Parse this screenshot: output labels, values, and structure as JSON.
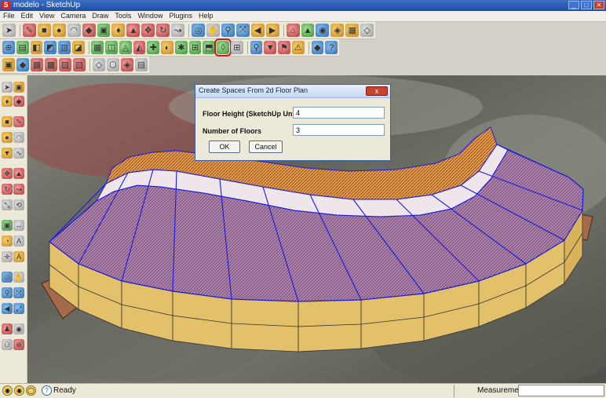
{
  "window": {
    "title": "modelo - SketchUp"
  },
  "menu": [
    "File",
    "Edit",
    "View",
    "Camera",
    "Draw",
    "Tools",
    "Window",
    "Plugins",
    "Help"
  ],
  "dialog": {
    "title": "Create Spaces From 2d Floor Plan",
    "close_label": "x",
    "fields": [
      {
        "label": "Floor Height (SketchUp Units)",
        "value": "4"
      },
      {
        "label": "Number of Floors",
        "value": "3"
      }
    ],
    "ok_label": "OK",
    "cancel_label": "Cancel"
  },
  "status": {
    "text": "Ready",
    "measurements_label": "Measurements",
    "measurements_value": ""
  },
  "colors": {
    "edge": "#1a1ae0",
    "wall": "#e3c06a",
    "roof": "#8b95c6",
    "highlight": "#e01010"
  }
}
